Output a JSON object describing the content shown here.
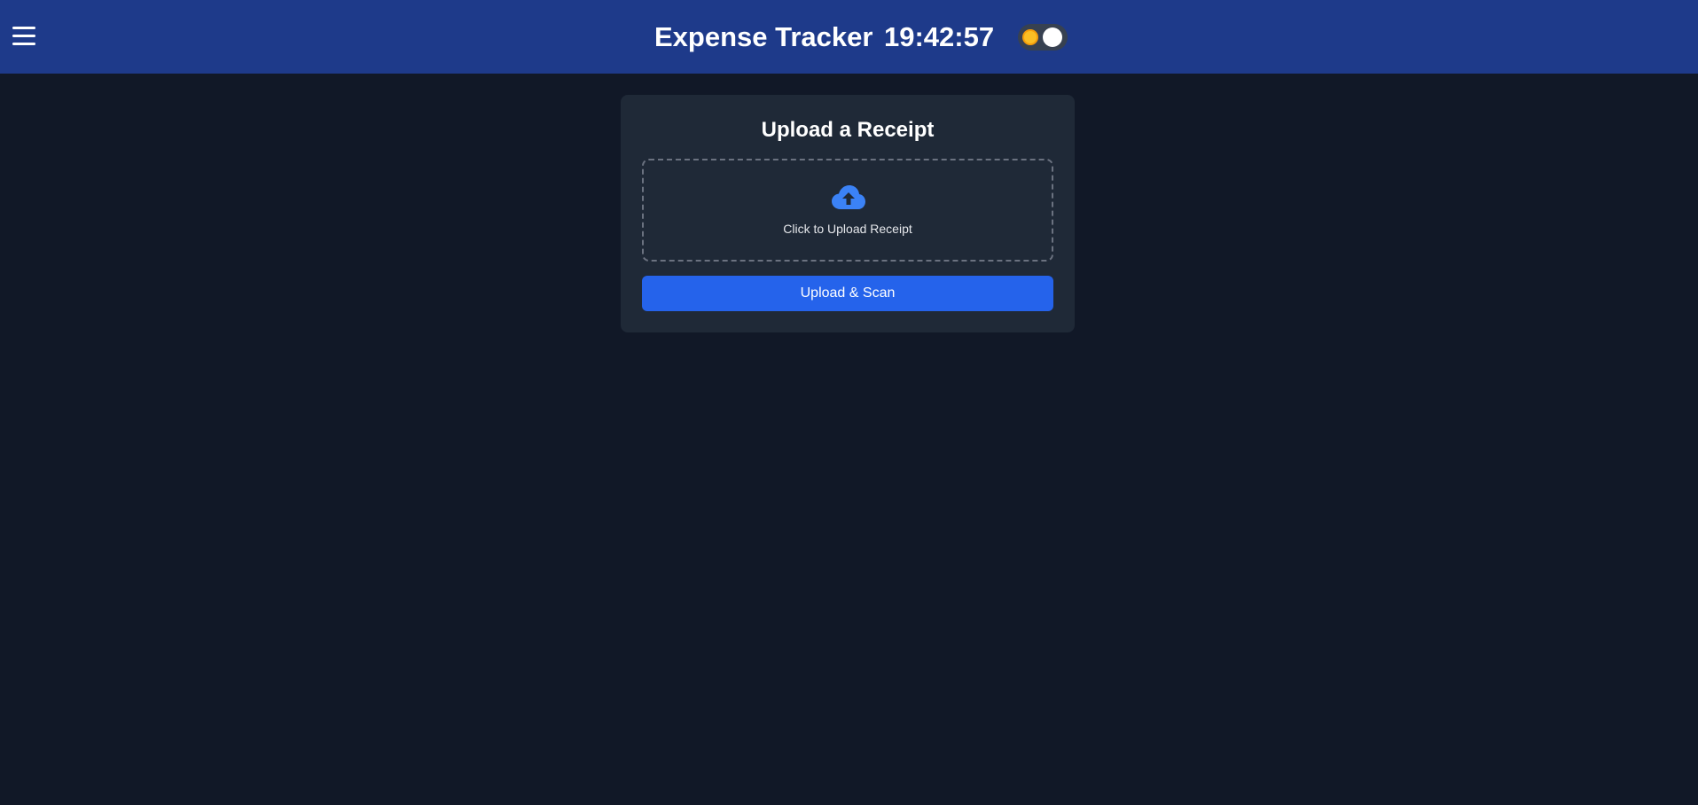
{
  "header": {
    "app_title": "Expense Tracker",
    "clock": "19:42:57",
    "menu_icon": "hamburger-menu-icon",
    "theme_toggle": {
      "icon": "sun-icon",
      "mode": "dark"
    }
  },
  "upload_card": {
    "title": "Upload a Receipt",
    "dropzone_icon": "cloud-upload-icon",
    "dropzone_label": "Click to Upload Receipt",
    "submit_label": "Upload & Scan"
  },
  "colors": {
    "background": "#111827",
    "header": "#1e3a8a",
    "card": "#1f2937",
    "accent": "#2563eb",
    "icon_blue": "#3b82f6"
  }
}
